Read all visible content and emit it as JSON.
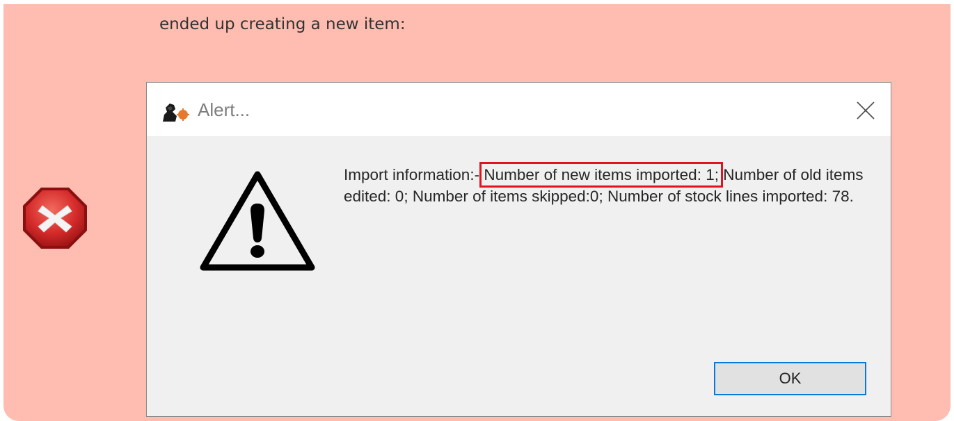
{
  "note": {
    "text": "ended up creating a new item:"
  },
  "icons": {
    "error": "error-stop-x-icon",
    "app": "app-logo-icon",
    "warning": "warning-triangle-icon",
    "close": "close-icon"
  },
  "colors": {
    "note_background": "#ffbcb1",
    "dialog_background": "#f0f0f0",
    "highlight_border": "#e0141e",
    "button_focus_border": "#0a78d7",
    "error_badge": "#d8262b"
  },
  "dialog": {
    "title": "Alert...",
    "message_prefix": "Import information:-",
    "message_highlight": "Number of new items imported: 1;",
    "message_suffix": "Number of old items edited: 0; Number of items skipped:0; Number of stock lines imported: 78.",
    "ok_label": "OK"
  }
}
